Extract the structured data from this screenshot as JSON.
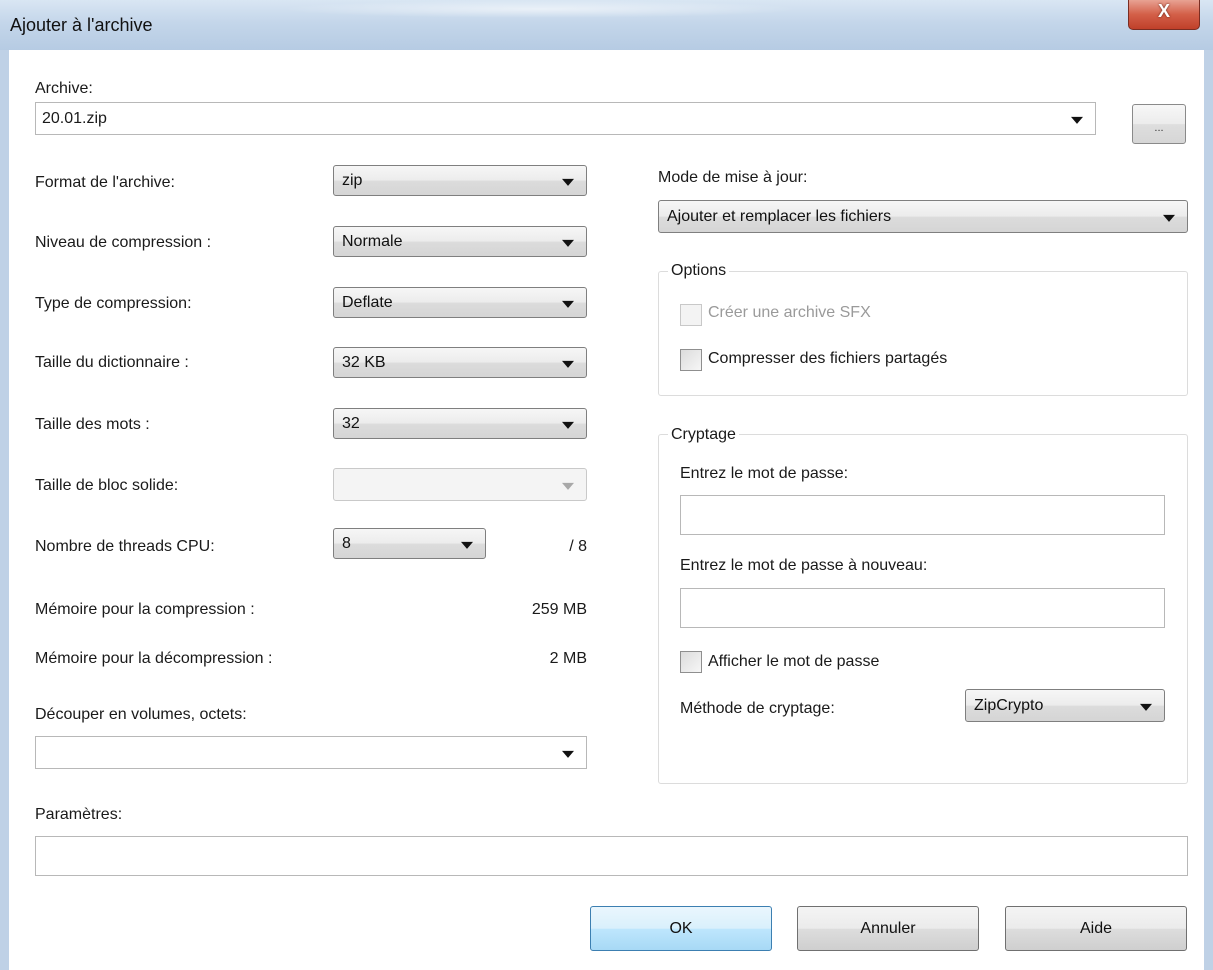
{
  "window": {
    "title": "Ajouter à l'archive",
    "close_glyph": "X"
  },
  "archive": {
    "label": "Archive:",
    "value": "20.01.zip",
    "browse_label": "..."
  },
  "left": {
    "format": {
      "label": "Format de l'archive:",
      "value": "zip"
    },
    "level": {
      "label": "Niveau de compression :",
      "value": "Normale"
    },
    "method": {
      "label": "Type de compression:",
      "value": "Deflate"
    },
    "dictionary": {
      "label": "Taille du dictionnaire :",
      "value": "32 KB"
    },
    "word": {
      "label": "Taille des mots :",
      "value": "32"
    },
    "solid": {
      "label": "Taille de bloc solide:",
      "value": ""
    },
    "threads": {
      "label": "Nombre de threads CPU:",
      "value": "8",
      "max": "/ 8"
    },
    "mem_compress": {
      "label": "Mémoire pour la compression :",
      "value": "259 MB"
    },
    "mem_decompress": {
      "label": "Mémoire pour la décompression :",
      "value": "2 MB"
    },
    "volumes": {
      "label": "Découper en volumes, octets:",
      "value": ""
    }
  },
  "right": {
    "update": {
      "label": "Mode de mise à jour:",
      "value": "Ajouter et remplacer les fichiers"
    },
    "options": {
      "title": "Options",
      "sfx_label": "Créer une archive SFX",
      "shared_label": "Compresser des fichiers partagés"
    },
    "encryption": {
      "title": "Cryptage",
      "password_label": "Entrez le mot de passe:",
      "password_value": "",
      "reenter_label": "Entrez le mot de passe à nouveau:",
      "reenter_value": "",
      "show_label": "Afficher le mot de passe",
      "method_label": "Méthode de cryptage:",
      "method_value": "ZipCrypto"
    }
  },
  "parameters": {
    "label": "Paramètres:",
    "value": ""
  },
  "buttons": {
    "ok": "OK",
    "cancel": "Annuler",
    "help": "Aide"
  }
}
